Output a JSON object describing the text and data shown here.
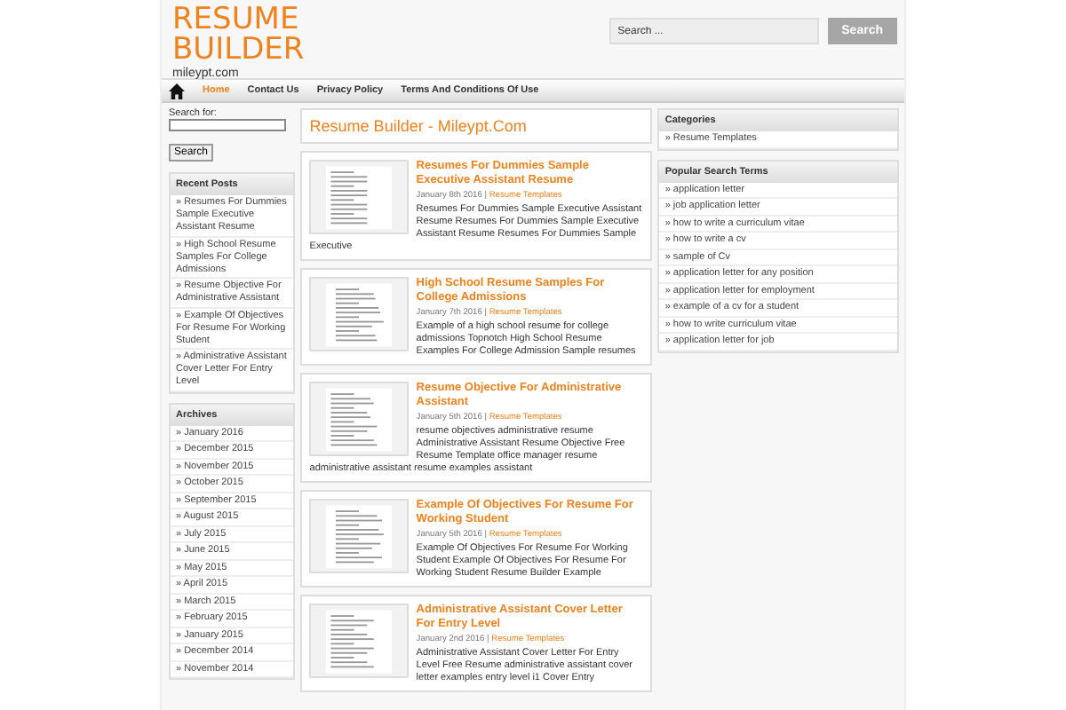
{
  "header": {
    "title_lines": [
      "RESUME",
      "BUILDER"
    ],
    "tagline": "mileypt.com",
    "search": {
      "placeholder": "Search ...",
      "button": "Search"
    }
  },
  "nav": [
    {
      "label": "Home",
      "selected": true
    },
    {
      "label": "Contact Us",
      "selected": false
    },
    {
      "label": "Privacy Policy",
      "selected": false
    },
    {
      "label": "Terms And Conditions Of Use",
      "selected": false
    }
  ],
  "left_sidebar": {
    "search_label": "Search for:",
    "search_button": "Search",
    "recent_posts": {
      "title": "Recent Posts",
      "items": [
        "» Resumes For Dummies Sample Executive Assistant Resume",
        "» High School Resume Samples For College Admissions",
        "» Resume Objective For Administrative Assistant",
        "» Example Of Objectives For Resume For Working Student",
        "» Administrative Assistant Cover Letter For Entry Level"
      ]
    },
    "archives": {
      "title": "Archives",
      "items": [
        "» January 2016",
        "» December 2015",
        "» November 2015",
        "» October 2015",
        "» September 2015",
        "» August 2015",
        "» July 2015",
        "» June 2015",
        "» May 2015",
        "» April 2015",
        "» March 2015",
        "» February 2015",
        "» January 2015",
        "» December 2014",
        "» November 2014"
      ]
    }
  },
  "main": {
    "heading": "Resume Builder - Mileypt.Com",
    "posts": [
      {
        "title": "Resumes For Dummies Sample Executive Assistant Resume",
        "date": "January 8th 2016",
        "separator": "|",
        "category": "Resume Templates",
        "excerpt": "Resumes For Dummies Sample Executive Assistant Resume Resumes For Dummies Sample Executive Assistant Resume Resumes For Dummies Sample Executive"
      },
      {
        "title": "High School Resume Samples For College Admissions",
        "date": "January 7th 2016",
        "separator": "|",
        "category": "Resume Templates",
        "excerpt": "Example of a high school resume for college admissions Topnotch High School Resume Examples For College Admission Sample resumes"
      },
      {
        "title": "Resume Objective For Administrative Assistant",
        "date": "January 5th 2016",
        "separator": "|",
        "category": "Resume Templates",
        "excerpt": "resume objectives administrative resume Administrative Assistant Resume Objective Free Resume Template office manager resume administrative assistant resume examples assistant"
      },
      {
        "title": "Example Of Objectives For Resume For Working Student",
        "date": "January 5th 2016",
        "separator": "|",
        "category": "Resume Templates",
        "excerpt": "Example Of Objectives For Resume For Working Student Example Of Objectives For Resume For Working Student Resume Builder Example"
      },
      {
        "title": "Administrative Assistant Cover Letter For Entry Level",
        "date": "January 2nd 2016",
        "separator": "|",
        "category": "Resume Templates",
        "excerpt": "Administrative Assistant Cover Letter For Entry Level Free Resume administrative assistant cover letter examples entry level i1 Cover Entry"
      }
    ]
  },
  "right_sidebar": {
    "categories": {
      "title": "Categories",
      "items": [
        "» Resume Templates"
      ]
    },
    "popular": {
      "title": "Popular Search Terms",
      "items": [
        "» application letter",
        "» job application letter",
        "» how to write a curriculum vitae",
        "» how to write a cv",
        "» sample of Cv",
        "» application letter for any position",
        "» application letter for employment",
        "» example of a cv for a student",
        "» how to write curriculum vitae",
        "» application letter for job"
      ]
    }
  }
}
